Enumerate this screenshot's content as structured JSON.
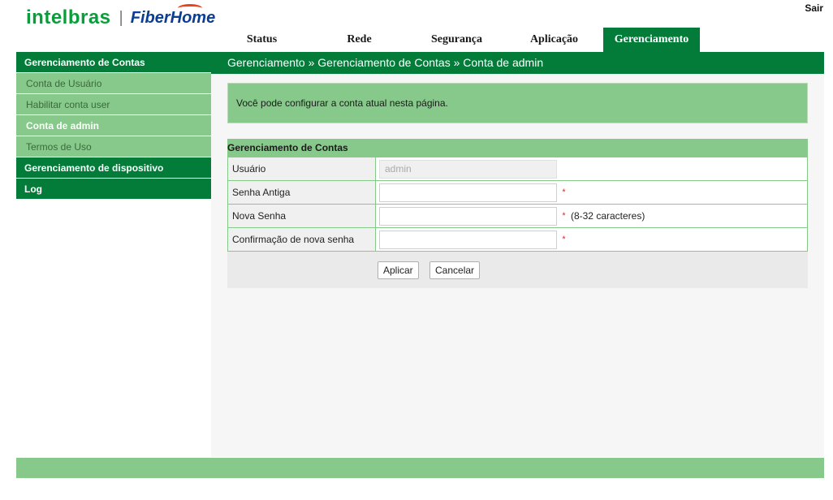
{
  "header": {
    "logo_left": "intelbras",
    "logo_separator": "|",
    "logo_right": "FiberHome",
    "logout_label": "Sair"
  },
  "topnav": {
    "items": [
      {
        "label": "Status"
      },
      {
        "label": "Rede"
      },
      {
        "label": "Segurança"
      },
      {
        "label": "Aplicação"
      },
      {
        "label": "Gerenciamento",
        "active": true
      }
    ]
  },
  "breadcrumb": "Gerenciamento » Gerenciamento de Contas » Conta de admin",
  "sidebar": {
    "group1": "Gerenciamento de Contas",
    "subs": [
      "Conta de Usuário",
      "Habilitar conta user",
      "Conta de admin",
      "Termos de Uso"
    ],
    "active_sub": "Conta de admin",
    "group2": "Gerenciamento de dispositivo",
    "group3": "Log"
  },
  "info_message": "Você pode configurar a conta atual nesta página.",
  "form": {
    "title": "Gerenciamento de Contas",
    "user_label": "Usuário",
    "user_value": "admin",
    "old_password_label": "Senha Antiga",
    "new_password_label": "Nova Senha",
    "new_password_hint": "(8-32 caracteres)",
    "confirm_label": "Confirmação de nova senha",
    "required_mark": "*",
    "apply_label": "Aplicar",
    "cancel_label": "Cancelar"
  },
  "colors": {
    "primary_green": "#037c3a",
    "light_green": "#87c98a",
    "logo_green": "#0a9e3a",
    "logo_blue": "#0b3d91",
    "required_red": "#d32f2f"
  }
}
